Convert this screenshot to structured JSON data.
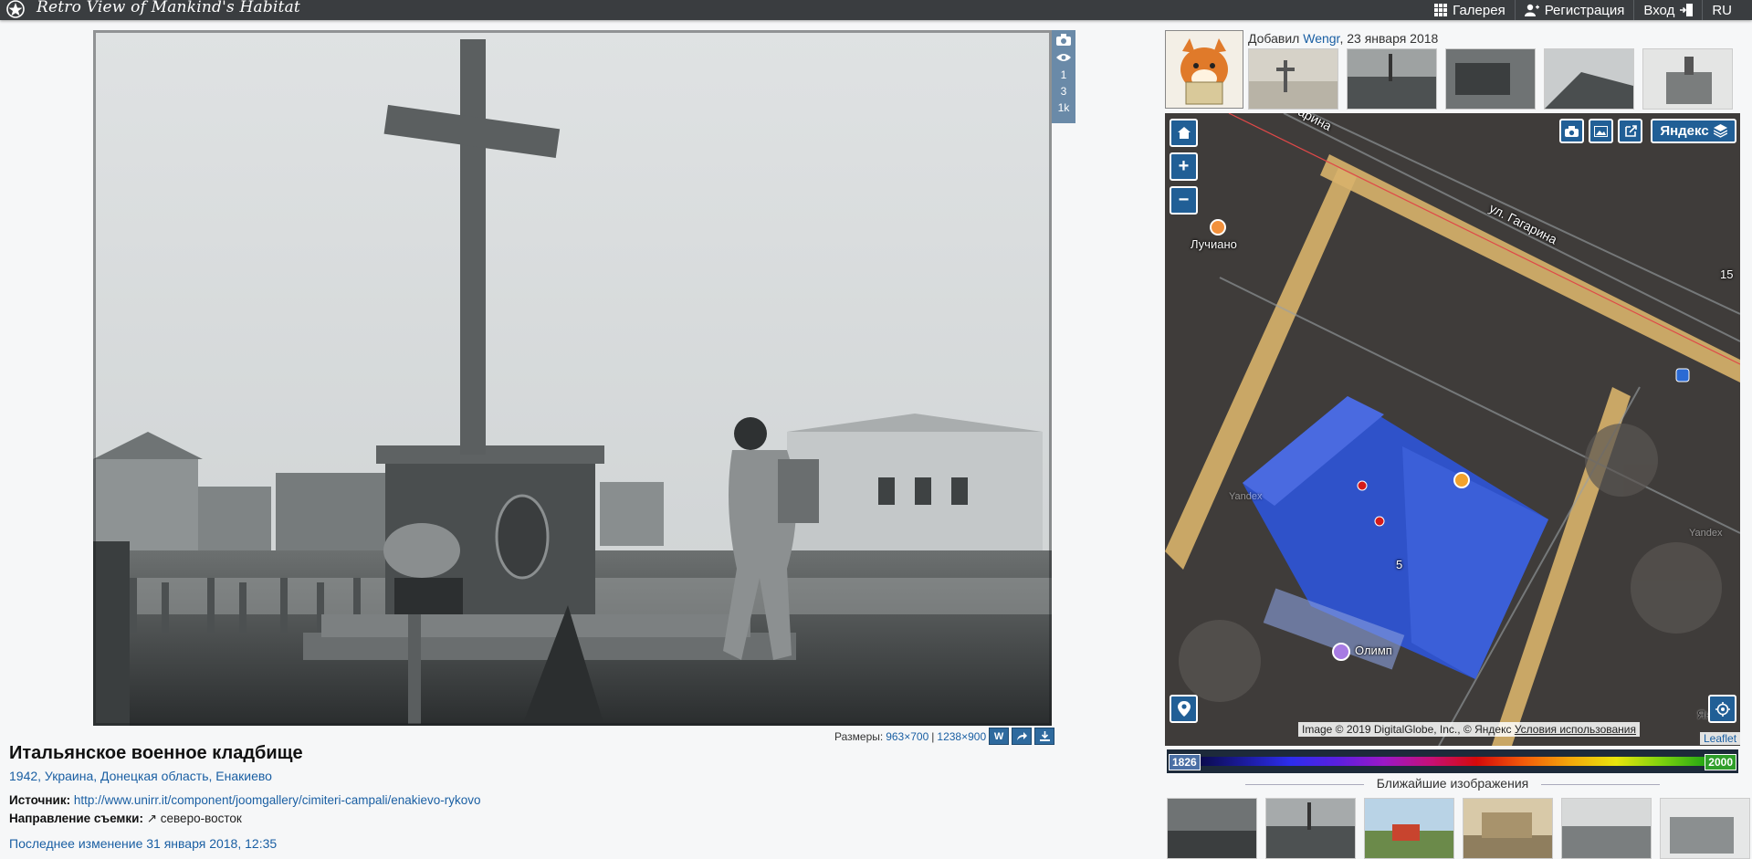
{
  "topbar": {
    "logo_text": "Retro View of Mankind's Habitat",
    "nav": [
      {
        "label": "Галерея",
        "icon": "grid-icon"
      },
      {
        "label": "Регистрация",
        "icon": "user-add-icon"
      },
      {
        "label": "Вход",
        "icon": "login-icon"
      },
      {
        "label": "RU",
        "icon": ""
      }
    ]
  },
  "photo": {
    "stats": [
      "1",
      "3",
      "1k"
    ],
    "sizes_label": "Размеры:",
    "size_small": "963×700",
    "size_sep": "|",
    "size_large": "1238×900",
    "btn_w": "W"
  },
  "title": "Итальянское военное кладбище",
  "subtitle": "1942, Украина, Донецкая область, Енакиево",
  "source_label": "Источник:",
  "source_url": "http://www.unirr.it/component/joomgallery/cimiteri-campali/enakievo-rykovo",
  "direction_label": "Направление съемки:",
  "direction_value": "↗ северо-восток",
  "last_modified": "Последнее изменение 31 января 2018, 12:35",
  "author": {
    "prefix": "Добавил",
    "name": "Wengr",
    "date": ", 23 января 2018"
  },
  "map": {
    "street": "ул. Гагарина",
    "street2": "арина",
    "place1": "Лучиано",
    "place2": "Олимп",
    "house_num": "5",
    "zoom_num": "15",
    "provider": "Яндекс",
    "watermark1": "Yandex",
    "watermark2": "Yandex",
    "watermark3": "Яндекс",
    "attribution": "Image © 2019 DigitalGlobe, Inc., © Яндекс",
    "terms": "Условия использования",
    "leaflet": "Leaflet",
    "year_from": "1826",
    "year_to": "2000"
  },
  "nearby_title": "Ближайшие изображения",
  "colors": {
    "topbar": "#3a3d40",
    "accent": "#215f96",
    "link": "#1a5fa3"
  }
}
